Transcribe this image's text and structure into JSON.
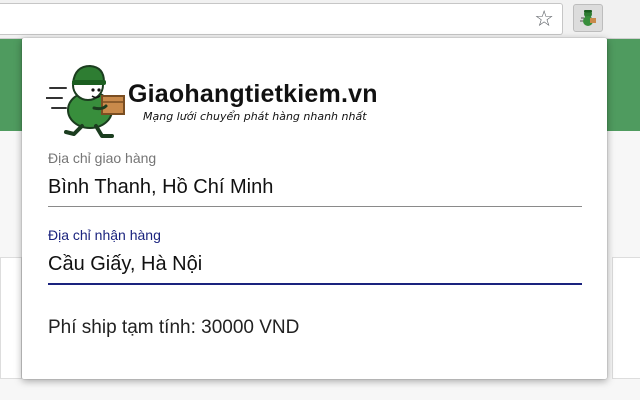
{
  "browser": {
    "bookmark_icon": "star-icon",
    "extension_icon": "shipper-mascot-icon"
  },
  "popup": {
    "brand": {
      "name": "Giaohangtietkiem.vn",
      "slogan": "Mạng lưới chuyển phát hàng nhanh nhất"
    },
    "from_field": {
      "label": "Địa chỉ giao hàng",
      "value": "Bình Thanh, Hồ Chí Minh"
    },
    "to_field": {
      "label": "Địa chỉ nhận hàng",
      "value": "Cầu Giấy, Hà Nội"
    },
    "fee_text": "Phí ship tạm tính: 30000 VND"
  },
  "colors": {
    "brand_green": "#4f9b5f",
    "active_accent": "#1a237e",
    "mascot_green": "#2e7d32",
    "box_orange": "#c98a4b"
  }
}
